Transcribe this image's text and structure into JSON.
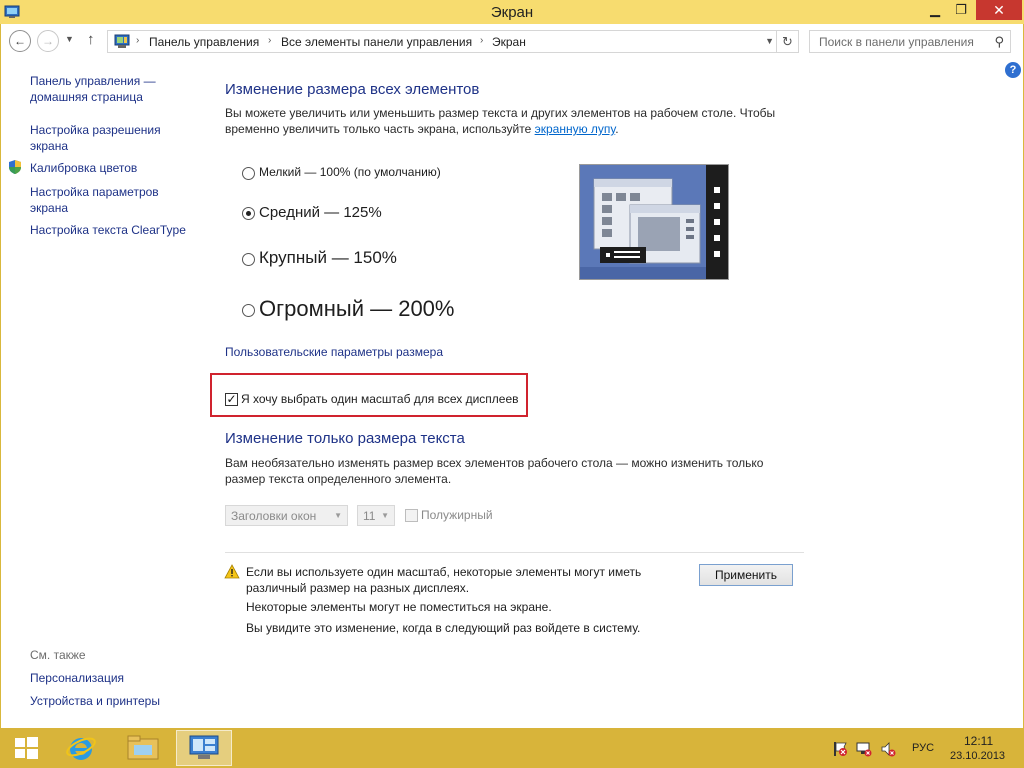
{
  "window": {
    "title": "Экран"
  },
  "navigation": {
    "breadcrumbs": [
      "Панель управления",
      "Все элементы панели управления",
      "Экран"
    ],
    "search_placeholder": "Поиск в панели управления"
  },
  "sidebar": {
    "links": [
      "Панель управления — домашняя страница",
      "Настройка разрешения экрана",
      "Калибровка цветов",
      "Настройка параметров экрана",
      "Настройка текста ClearType"
    ],
    "see_also_label": "См. также",
    "see_also": [
      "Персонализация",
      "Устройства и принтеры"
    ]
  },
  "main": {
    "section1_title": "Изменение размера всех элементов",
    "section1_desc": "Вы можете увеличить или уменьшить размер текста и других элементов на рабочем столе. Чтобы временно увеличить только часть экрана, используйте",
    "section1_link": "экранную лупу",
    "section1_desc_end": ".",
    "options": [
      {
        "label": "Мелкий — 100% (по умолчанию)",
        "checked": false
      },
      {
        "label": "Средний — 125%",
        "checked": true
      },
      {
        "label": "Крупный — 150%",
        "checked": false
      },
      {
        "label": "Огромный — 200%",
        "checked": false
      }
    ],
    "custom_link": "Пользовательские параметры размера",
    "one_scale_checkbox": "Я хочу выбрать один масштаб для всех дисплеев",
    "section2_title": "Изменение только размера текста",
    "section2_desc": "Вам необязательно изменять размер всех элементов рабочего стола — можно изменить только размер текста определенного элемента.",
    "element_select": "Заголовки окон",
    "size_select": "11",
    "bold_label": "Полужирный",
    "warning_lines": [
      "Если вы используете один масштаб, некоторые элементы могут иметь различный размер на разных дисплеях.",
      "Некоторые элементы могут не поместиться на экране.",
      "Вы увидите это изменение, когда в следующий раз войдете в систему."
    ],
    "apply_button": "Применить"
  },
  "taskbar": {
    "language": "РУС",
    "time": "12:11",
    "date": "23.10.2013"
  },
  "colors": {
    "titlebar": "#f7dc6f",
    "taskbar": "#d8b43a",
    "link": "#1e3287",
    "close": "#c7372f"
  }
}
